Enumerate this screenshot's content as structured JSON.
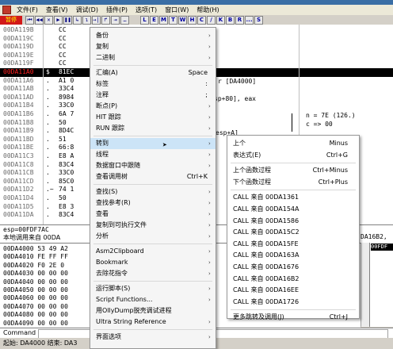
{
  "menubar": {
    "items": [
      "文件(F)",
      "查看(V)",
      "调试(D)",
      "插件(P)",
      "选项(T)",
      "窗口(W)",
      "帮助(H)"
    ]
  },
  "toolbar": {
    "status_badge": "暂停",
    "nav_buttons": [
      "⏮",
      "◀◀",
      "✕",
      "▶",
      "❚❚",
      "↳",
      "↴",
      "→|",
      "↱",
      "⇥",
      "…"
    ],
    "letter_buttons": [
      "L",
      "E",
      "M",
      "T",
      "W",
      "H",
      "C",
      "/",
      "K",
      "B",
      "R",
      "...",
      "S"
    ]
  },
  "disasm": {
    "rows": [
      {
        "addr": "00DA119B",
        "mk": "",
        "hex": "CC"
      },
      {
        "addr": "00DA119C",
        "mk": "",
        "hex": "CC"
      },
      {
        "addr": "00DA119D",
        "mk": "",
        "hex": "CC"
      },
      {
        "addr": "00DA119E",
        "mk": "",
        "hex": "CC"
      },
      {
        "addr": "00DA119F",
        "mk": "",
        "hex": "CC"
      },
      {
        "addr": "00DA11A0",
        "mk": "$",
        "hex": "81EC",
        "selected": true
      },
      {
        "addr": "00DA11A6",
        "mk": ".",
        "hex": "A1 0"
      },
      {
        "addr": "00DA11AB",
        "mk": ".",
        "hex": "33C4"
      },
      {
        "addr": "00DA11AD",
        "mk": ".",
        "hex": "8984"
      },
      {
        "addr": "00DA11B4",
        "mk": ".",
        "hex": "33C0"
      },
      {
        "addr": "00DA11B6",
        "mk": ".",
        "hex": "6A 7"
      },
      {
        "addr": "00DA11B8",
        "mk": ".",
        "hex": "50"
      },
      {
        "addr": "00DA11B9",
        "mk": ".",
        "hex": "8D4C"
      },
      {
        "addr": "00DA11BD",
        "mk": ".",
        "hex": "51"
      },
      {
        "addr": "00DA11BE",
        "mk": ".",
        "hex": "66:8"
      },
      {
        "addr": "00DA11C3",
        "mk": ".",
        "hex": "E8 A"
      },
      {
        "addr": "00DA11C8",
        "mk": ".",
        "hex": "83C4"
      },
      {
        "addr": "00DA11CB",
        "mk": ".",
        "hex": "33C0"
      },
      {
        "addr": "00DA11CD",
        "mk": ".",
        "hex": "85C0"
      },
      {
        "addr": "00DA11D2",
        "mk": ".~",
        "hex": "74 1"
      },
      {
        "addr": "00DA11D4",
        "mk": ".",
        "hex": "50"
      },
      {
        "addr": "00DA11D5",
        "mk": ".",
        "hex": "E8 3"
      },
      {
        "addr": "00DA11DA",
        "mk": ".",
        "hex": "83C4"
      }
    ],
    "annotations": {
      "a1": "r [DA4000]",
      "a2": "sp+80], eax",
      "a3": "esp+A]",
      "n_hint": "n = 7E (126.)",
      "c_hint": "c => 00"
    }
  },
  "info": {
    "esp_line": "esp=00FDF7AC",
    "local_call": "本地调用来自  00DA",
    "right_text": "DA16B2,"
  },
  "dump": {
    "rows": [
      "00DA4000 53 49 A2",
      "00DA4010 FE FF FF",
      "00DA4020 F0 2E 0",
      "00DA4030 00 00 00",
      "00DA4040 00 00 00",
      "00DA4050 00 00 00",
      "00DA4060 00 00 00",
      "00DA4070 00 00 00",
      "00DA4080 00 00 00",
      "00DA4090 00 00 00"
    ],
    "stack_header": "00FDF"
  },
  "command": {
    "label": "Command"
  },
  "statusbar": {
    "text": "起始: DA4000  结束: DA3"
  },
  "context_menu": {
    "items": [
      {
        "label": "备份",
        "arrow": true
      },
      {
        "label": "复制",
        "arrow": true
      },
      {
        "label": "二进制",
        "arrow": true
      },
      {
        "label": "汇编(A)",
        "shortcut": "Space"
      },
      {
        "label": "标签",
        "shortcut": ":"
      },
      {
        "label": "注释",
        "shortcut": ";"
      },
      {
        "label": "断点(P)",
        "arrow": true
      },
      {
        "label": "HIT 跟踪",
        "arrow": true
      },
      {
        "label": "RUN 跟踪",
        "arrow": true
      },
      {
        "label": "转到",
        "arrow": true,
        "highlighted": true
      },
      {
        "label": "线程",
        "arrow": true
      },
      {
        "label": "数据窗口中跟随",
        "arrow": true
      },
      {
        "label": "查看调用树",
        "shortcut": "Ctrl+K"
      },
      {
        "label": "查找(S)",
        "arrow": true
      },
      {
        "label": "查找参考(R)",
        "arrow": true
      },
      {
        "label": "查看",
        "arrow": true
      },
      {
        "label": "复制到可执行文件",
        "arrow": true
      },
      {
        "label": "分析",
        "arrow": true
      },
      {
        "label": "Asm2Clipboard",
        "arrow": true
      },
      {
        "label": "Bookmark",
        "arrow": true
      },
      {
        "label": "去除花指令",
        "arrow": true
      },
      {
        "label": "运行脚本(S)",
        "arrow": true
      },
      {
        "label": "Script Functions...",
        "arrow": true
      },
      {
        "label": "用OllyDump脱壳调试进程",
        "arrow": false
      },
      {
        "label": "Ultra String Reference",
        "arrow": true
      },
      {
        "label": "界面选项",
        "arrow": true
      }
    ]
  },
  "submenu": {
    "items": [
      {
        "label": "上个",
        "shortcut": "Minus"
      },
      {
        "label": "表达式(E)",
        "shortcut": "Ctrl+G"
      },
      {
        "label": "上个函数过程",
        "shortcut": "Ctrl+Minus"
      },
      {
        "label": "下个函数过程",
        "shortcut": "Ctrl+Plus"
      },
      {
        "label": "CALL 来自 00DA1361"
      },
      {
        "label": "CALL 来自 00DA154A"
      },
      {
        "label": "CALL 来自 00DA1586"
      },
      {
        "label": "CALL 来自 00DA15C2"
      },
      {
        "label": "CALL 来自 00DA15FE"
      },
      {
        "label": "CALL 来自 00DA163A"
      },
      {
        "label": "CALL 来自 00DA1676"
      },
      {
        "label": "CALL 来自 00DA16B2"
      },
      {
        "label": "CALL 来自 00DA16EE"
      },
      {
        "label": "CALL 来自 00DA1726"
      },
      {
        "label": "更多跳转及调用(J)",
        "shortcut": "Ctrl+J"
      }
    ]
  }
}
